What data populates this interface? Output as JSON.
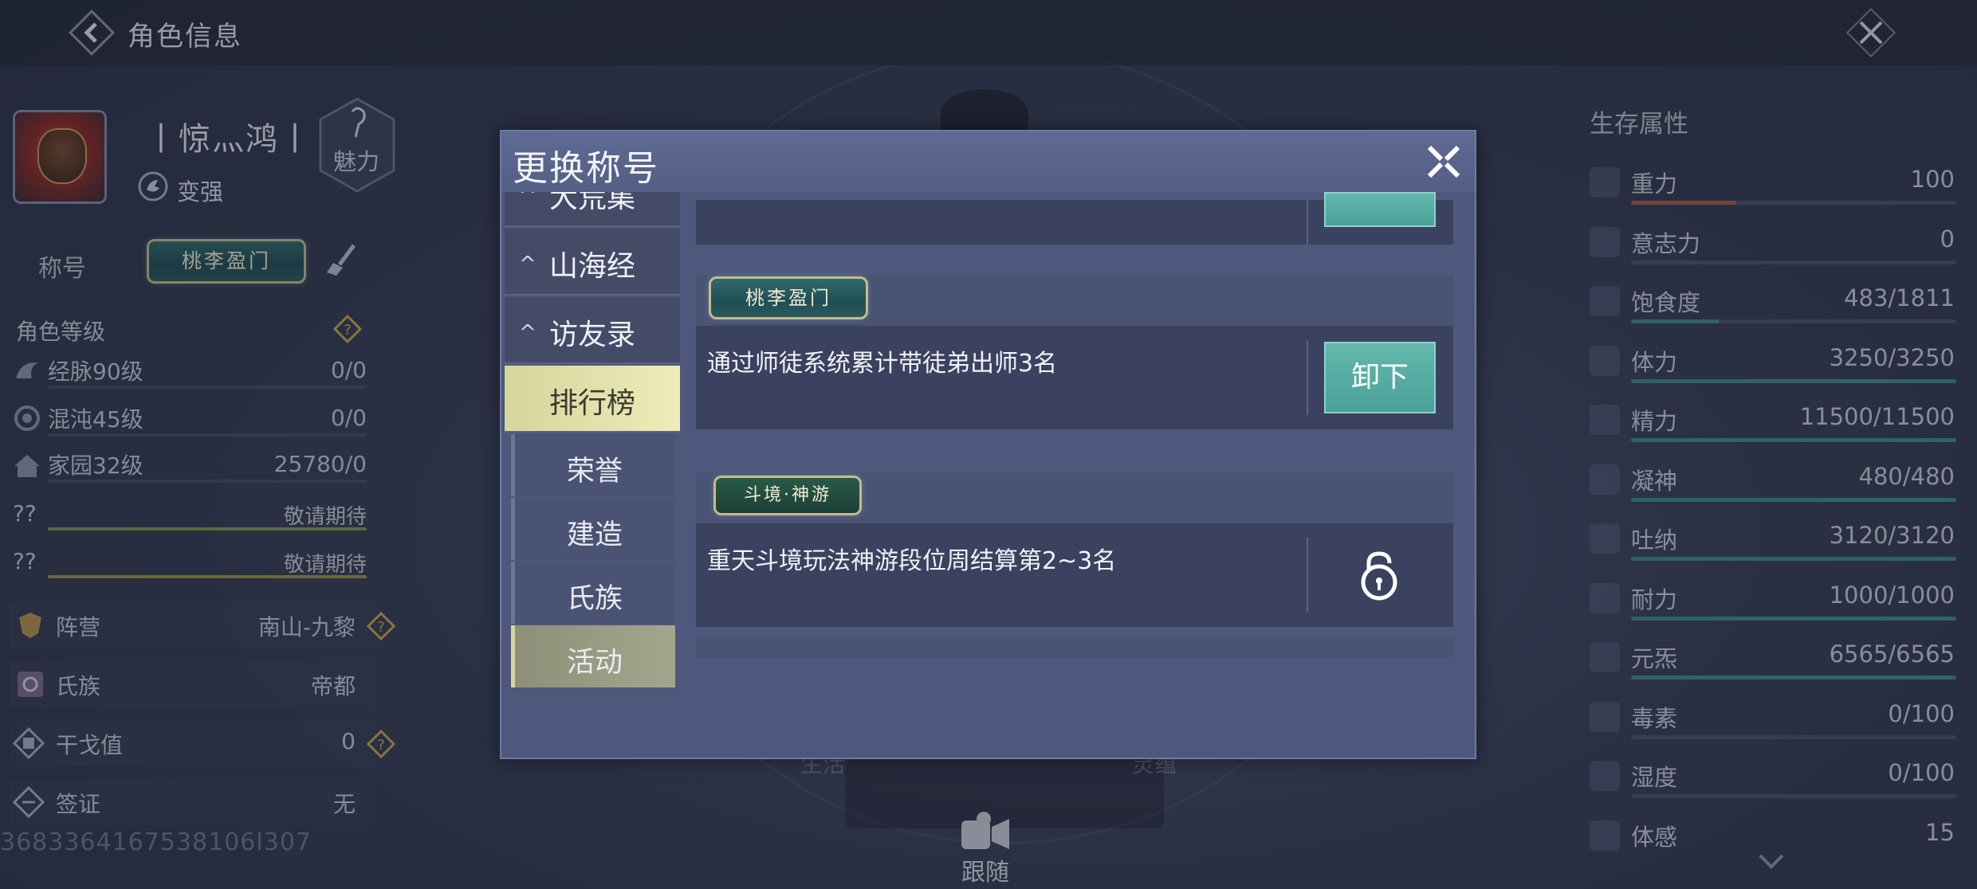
{
  "header": {
    "title": "角色信息"
  },
  "profile": {
    "name": "丨惊灬鸿丨",
    "strengthen_label": "变强",
    "charm_label": "魅力",
    "title_row_label": "称号",
    "current_title_badge": "桃李盈门"
  },
  "level": {
    "heading": "角色等级",
    "rows": [
      {
        "label": "经脉90级",
        "value": "0/0"
      },
      {
        "label": "混沌45级",
        "value": "0/0"
      },
      {
        "label": "家园32级",
        "value": "25780/0"
      },
      {
        "label": "??",
        "value": "敬请期待"
      },
      {
        "label": "??",
        "value": "敬请期待"
      }
    ]
  },
  "affiliation": [
    {
      "label": "阵营",
      "value": "南山-九黎"
    },
    {
      "label": "氏族",
      "value": "帝都"
    },
    {
      "label": "干戈值",
      "value": "0"
    },
    {
      "label": "签证",
      "value": "无"
    }
  ],
  "uid": "3683364167538106l307",
  "survival": {
    "title": "生存属性",
    "rows": [
      {
        "icon": "gravity-icon",
        "label": "重力",
        "value": "100",
        "fill": 0.32
      },
      {
        "icon": "willpower-icon",
        "label": "意志力",
        "value": "0",
        "fill": 0.0
      },
      {
        "icon": "satiety-icon",
        "label": "饱食度",
        "value": "483/1811",
        "fill": 0.27
      },
      {
        "icon": "stamina-icon",
        "label": "体力",
        "value": "3250/3250",
        "fill": 1.0
      },
      {
        "icon": "energy-icon",
        "label": "精力",
        "value": "11500/11500",
        "fill": 1.0
      },
      {
        "icon": "focus-icon",
        "label": "凝神",
        "value": "480/480",
        "fill": 1.0
      },
      {
        "icon": "breath-icon",
        "label": "吐纳",
        "value": "3120/3120",
        "fill": 1.0
      },
      {
        "icon": "endurance-icon",
        "label": "耐力",
        "value": "1000/1000",
        "fill": 1.0
      },
      {
        "icon": "yuanqi-icon",
        "label": "元炁",
        "value": "6565/6565",
        "fill": 1.0
      },
      {
        "icon": "toxin-icon",
        "label": "毒素",
        "value": "0/100",
        "fill": 0.0
      },
      {
        "icon": "humidity-icon",
        "label": "湿度",
        "value": "0/100",
        "fill": 0.0
      },
      {
        "icon": "body-temp-icon",
        "label": "体感",
        "value": "15",
        "fill": 0.0
      }
    ]
  },
  "bottom": {
    "follow_label": "跟随",
    "faded_left": "生活",
    "faded_right": "灵蕴"
  },
  "modal": {
    "title": "更换称号",
    "nav": [
      {
        "label": "大荒集",
        "caret": "^",
        "active": false
      },
      {
        "label": "山海经",
        "caret": "^",
        "active": false
      },
      {
        "label": "访友录",
        "caret": "^",
        "active": false
      },
      {
        "label": "排行榜",
        "caret": "",
        "active": true
      }
    ],
    "subnav": [
      {
        "label": "荣誉",
        "active": false
      },
      {
        "label": "建造",
        "active": false
      },
      {
        "label": "氏族",
        "active": false
      },
      {
        "label": "活动",
        "active": true
      }
    ],
    "cards": [
      {
        "badge": "桃李盈门",
        "description": "通过师徒系统累计带徒弟出师3名",
        "action": "卸下",
        "locked": false
      },
      {
        "badge": "斗境·神游",
        "description": "重天斗境玩法神游段位周结算第2~3名",
        "action": "",
        "locked": true
      }
    ]
  },
  "colors": {
    "accent_teal": "#4aa197",
    "active_nav": "#eeecb8",
    "panel": "#4e587c"
  }
}
